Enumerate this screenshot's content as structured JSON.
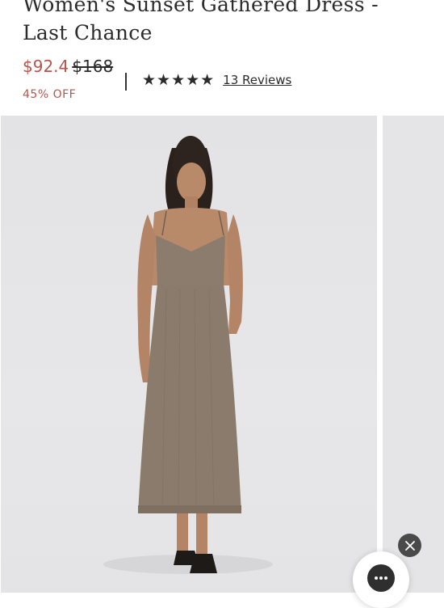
{
  "product": {
    "title": "Women's Sunset Gathered Dress - Last Chance",
    "sale_price": "$92.4",
    "original_price": "$168",
    "discount": "45% OFF",
    "rating_stars": "★★★★★",
    "reviews_label": "13 Reviews"
  },
  "gallery": {
    "dress_color": "#8b7b6c",
    "background_color": "#e5e5e7"
  },
  "colors": {
    "sale": "#b5554b",
    "text": "#2b2b2b"
  },
  "icons": {
    "close": "close-icon",
    "chat": "chat-dots-icon"
  }
}
